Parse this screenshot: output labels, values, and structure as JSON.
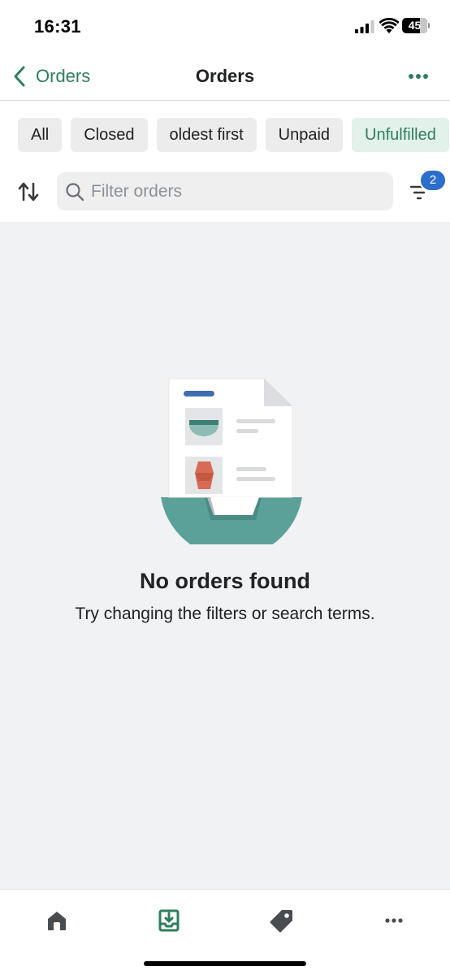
{
  "status_bar": {
    "time": "16:31",
    "battery_level": "45"
  },
  "nav": {
    "back_label": "Orders",
    "title": "Orders"
  },
  "filter_chips": [
    {
      "label": "All",
      "active": false
    },
    {
      "label": "Closed",
      "active": false
    },
    {
      "label": "oldest first",
      "active": false
    },
    {
      "label": "Unpaid",
      "active": false
    },
    {
      "label": "Unfulfilled",
      "active": true
    }
  ],
  "search": {
    "placeholder": "Filter orders",
    "value": ""
  },
  "filters": {
    "active_count": "2"
  },
  "empty_state": {
    "title": "No orders found",
    "subtitle": "Try changing the filters or search terms."
  },
  "tab_bar": {
    "items": [
      {
        "icon": "home-icon",
        "active": false
      },
      {
        "icon": "orders-icon",
        "active": true
      },
      {
        "icon": "tag-icon",
        "active": false
      },
      {
        "icon": "more-icon",
        "active": false
      }
    ]
  },
  "colors": {
    "accent": "#2f7d5f",
    "badge": "#2c6ecb",
    "background": "#f1f2f3",
    "illustration_teal": "#5ba199"
  }
}
